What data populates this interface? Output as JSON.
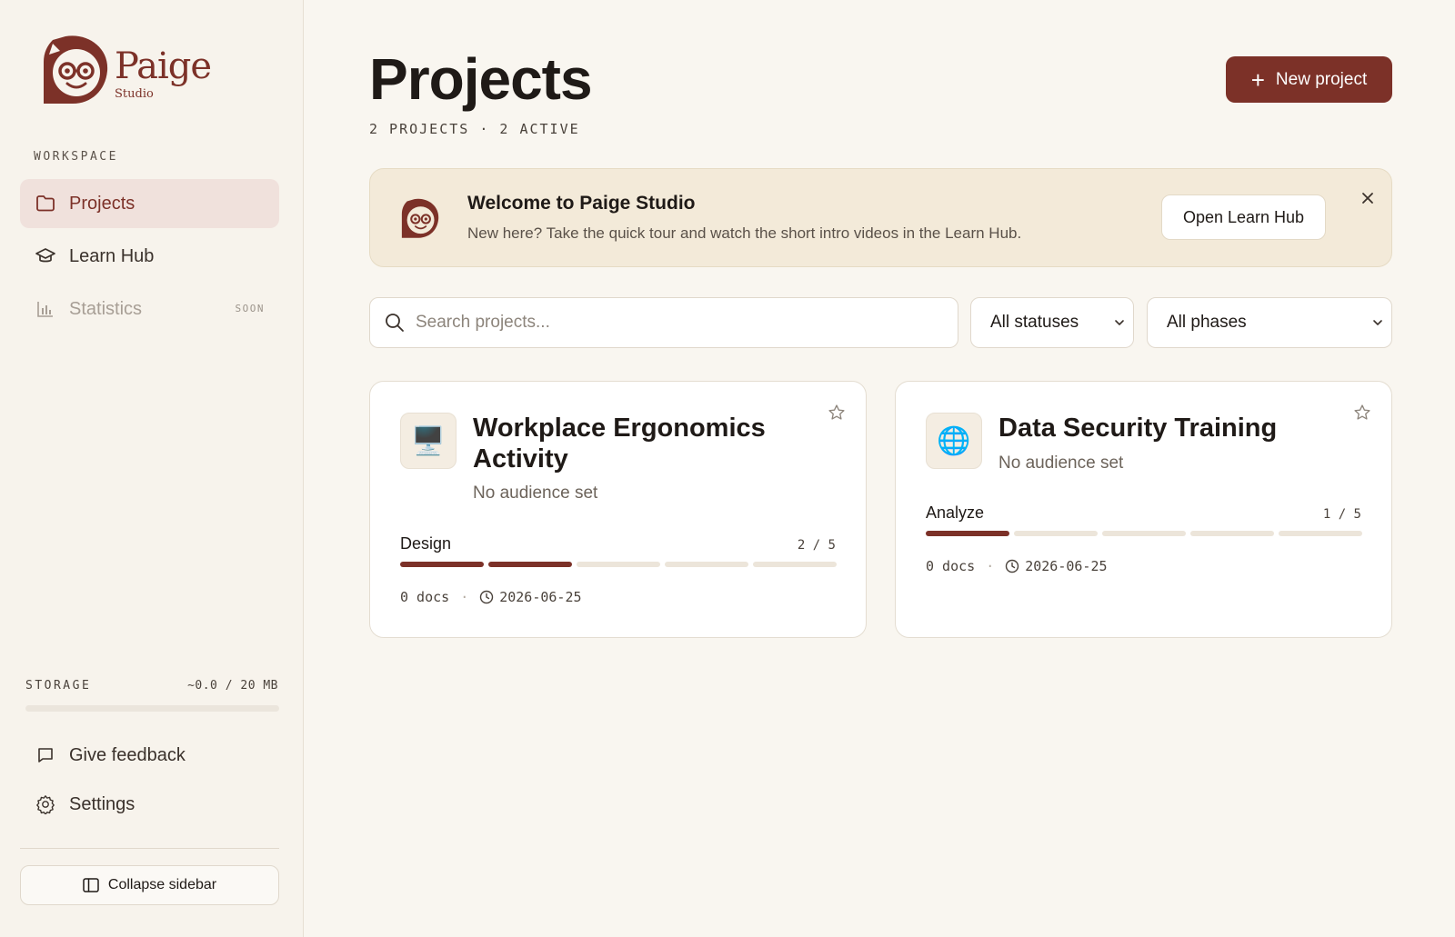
{
  "brand": {
    "name": "Paige",
    "sub": "Studio",
    "color": "#7c3128"
  },
  "sidebar": {
    "section_label": "WORKSPACE",
    "items": [
      {
        "label": "Projects",
        "icon": "folder-icon",
        "active": true
      },
      {
        "label": "Learn Hub",
        "icon": "graduation-cap-icon"
      },
      {
        "label": "Statistics",
        "icon": "bar-chart-icon",
        "badge": "SOON",
        "disabled": true
      }
    ],
    "storage": {
      "label": "STORAGE",
      "value": "~0.0 / 20 MB",
      "fraction": 0.0
    },
    "feedback_label": "Give feedback",
    "settings_label": "Settings",
    "collapse_label": "Collapse sidebar"
  },
  "header": {
    "title": "Projects",
    "subtitle": "2 PROJECTS · 2 ACTIVE",
    "new_button": "New project"
  },
  "welcome": {
    "title": "Welcome to Paige Studio",
    "text": "New here? Take the quick tour and watch the short intro videos in the Learn Hub.",
    "button": "Open Learn Hub"
  },
  "filters": {
    "search_placeholder": "Search projects...",
    "status": "All statuses",
    "phase": "All phases"
  },
  "projects": [
    {
      "icon": "🖥️",
      "title": "Workplace Ergonomics Activity",
      "audience": "No audience set",
      "phase": "Design",
      "phase_count": "2 / 5",
      "progress": 2,
      "docs": "0 docs",
      "date": "2026-06-25"
    },
    {
      "icon": "🌐",
      "title": "Data Security Training",
      "audience": "No audience set",
      "phase": "Analyze",
      "phase_count": "1 / 5",
      "progress": 1,
      "docs": "0 docs",
      "date": "2026-06-25"
    }
  ]
}
